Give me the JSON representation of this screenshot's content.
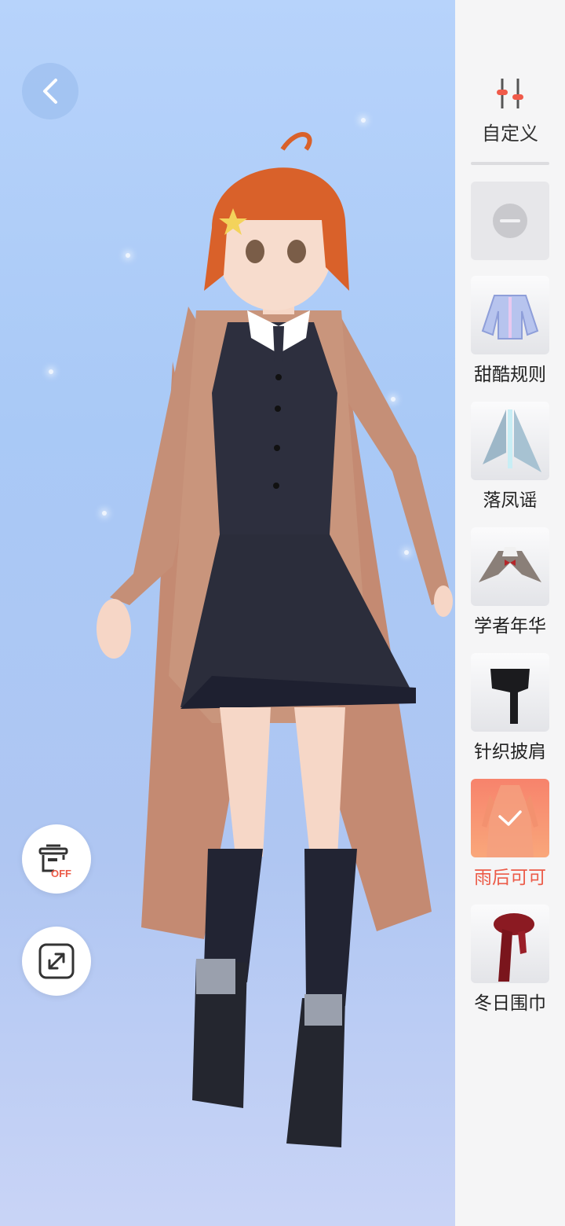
{
  "sidebar": {
    "custom_label": "自定义",
    "items": [
      {
        "label": "",
        "icon": "none-icon"
      },
      {
        "label": "甜酷规则",
        "icon": "jacket-icon"
      },
      {
        "label": "落凤谣",
        "icon": "veil-icon"
      },
      {
        "label": "学者年华",
        "icon": "capelet-icon"
      },
      {
        "label": "针织披肩",
        "icon": "knit-shawl-icon"
      },
      {
        "label": "雨后可可",
        "icon": "long-coat-icon",
        "selected": true
      },
      {
        "label": "冬日围巾",
        "icon": "scarf-icon"
      }
    ]
  },
  "controls": {
    "back": "back-icon",
    "box_off_badge": "OFF",
    "expand": "expand-icon"
  },
  "colors": {
    "accent": "#ec5b48",
    "panel_bg": "#f5f5f6",
    "stage_top": "#b7d3fb"
  }
}
